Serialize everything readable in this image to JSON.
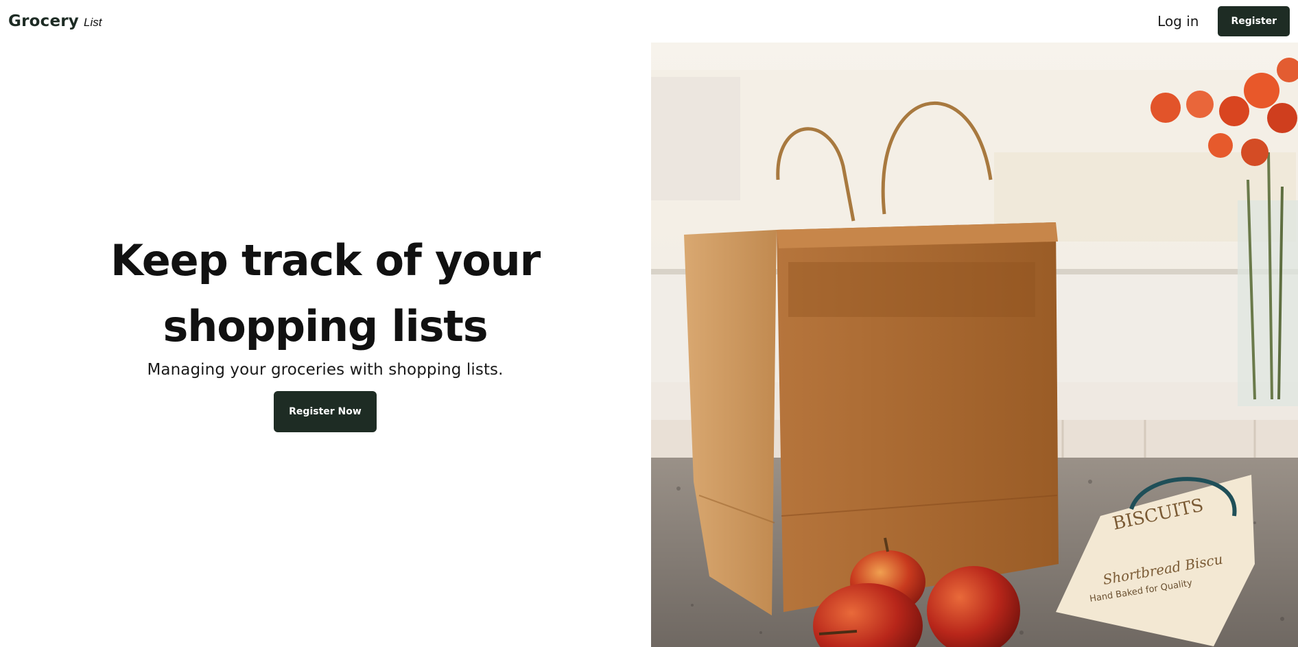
{
  "navbar": {
    "brand_main": "Grocery",
    "brand_sub": "List",
    "login_label": "Log in",
    "register_label": "Register"
  },
  "hero": {
    "title": "Keep track of your shopping lists",
    "subtitle": "Managing your groceries with shopping lists.",
    "cta_label": "Register Now"
  },
  "image": {
    "bag_text_1": "BISCUITS",
    "bag_text_2": "Shortbread Biscu",
    "bag_text_3": "Hand Baked for Quality"
  },
  "colors": {
    "primary": "#1e2c24",
    "text": "#111111",
    "background": "#ffffff"
  }
}
